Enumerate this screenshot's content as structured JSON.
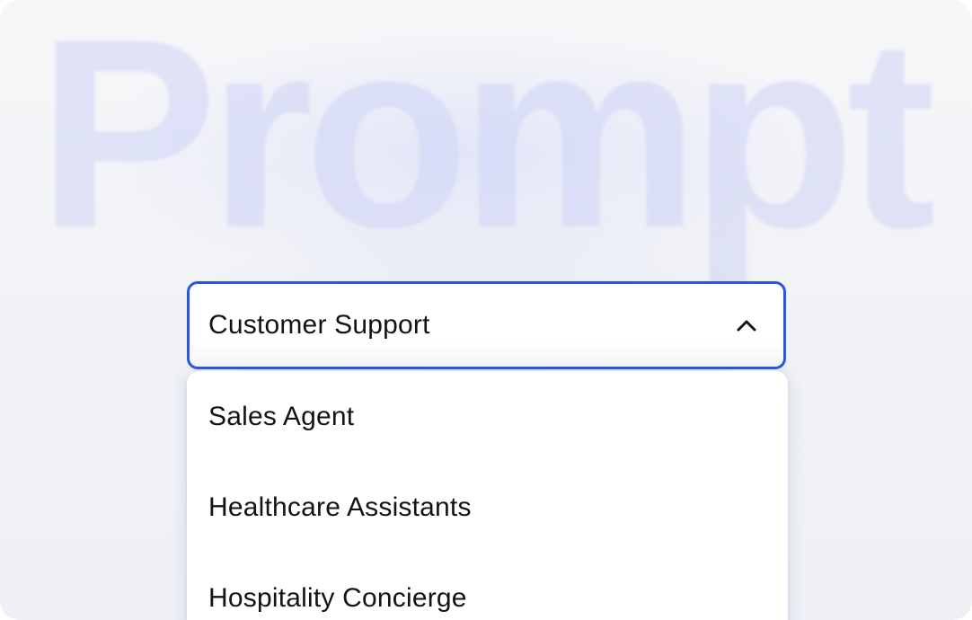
{
  "watermark": {
    "text": "Prompt"
  },
  "select": {
    "value": "Customer Support",
    "state": "open",
    "accent_color": "#2a55e5",
    "toggle_icon": "chevron-up-icon"
  },
  "dropdown": {
    "options": [
      {
        "label": "Sales Agent"
      },
      {
        "label": "Healthcare Assistants"
      },
      {
        "label": "Hospitality Concierge"
      }
    ]
  }
}
